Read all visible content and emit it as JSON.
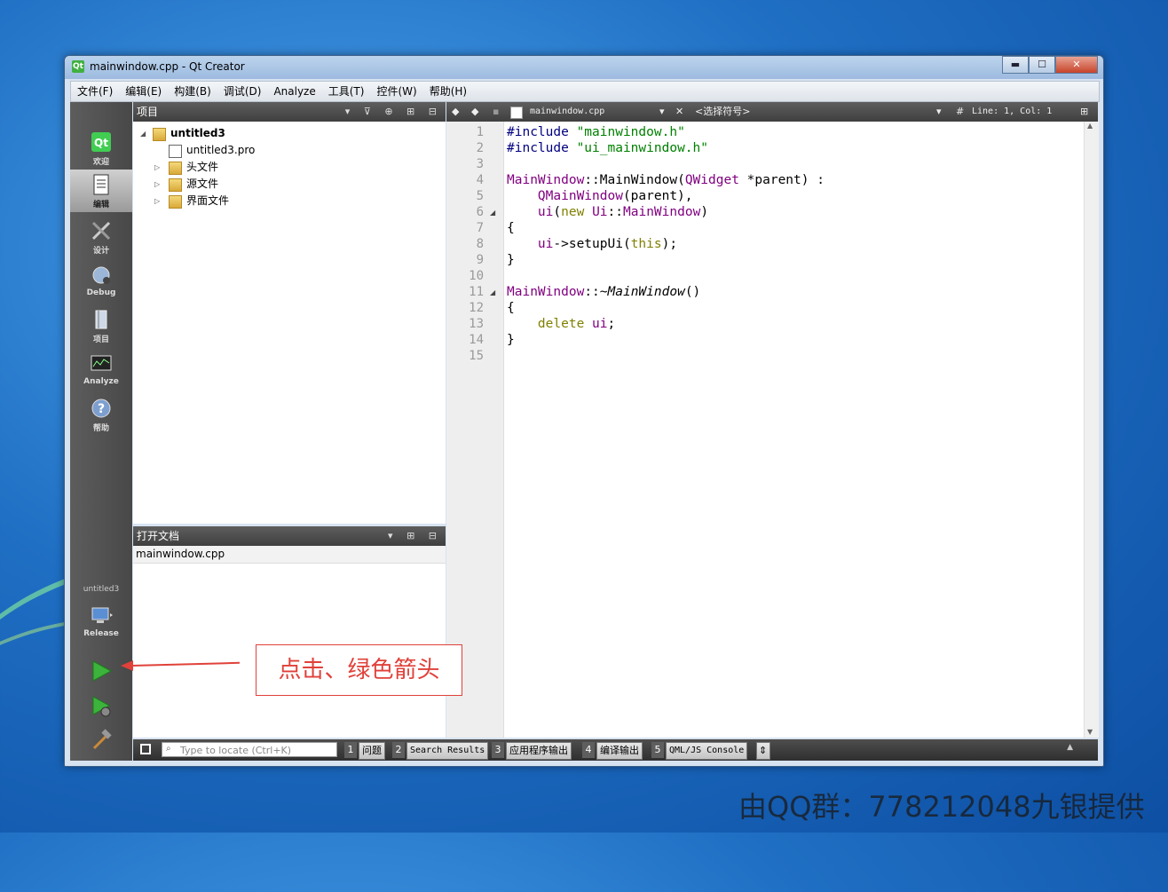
{
  "window": {
    "title": "mainwindow.cpp - Qt Creator",
    "app_icon_text": "Qt",
    "min": "▬",
    "max": "☐",
    "close": "✕"
  },
  "menu": [
    "文件(F)",
    "编辑(E)",
    "构建(B)",
    "调试(D)",
    "Analyze",
    "工具(T)",
    "控件(W)",
    "帮助(H)"
  ],
  "modes": {
    "welcome": "欢迎",
    "edit": "编辑",
    "design": "设计",
    "debug": "Debug",
    "projects": "项目",
    "analyze": "Analyze",
    "help": "帮助"
  },
  "build": {
    "project": "untitled3",
    "config": "Release"
  },
  "project_panel": {
    "title": "项目",
    "tree": [
      {
        "label": "untitled3",
        "level": 0,
        "bold": true
      },
      {
        "label": "untitled3.pro",
        "level": 1
      },
      {
        "label": "头文件",
        "level": 1
      },
      {
        "label": "源文件",
        "level": 1
      },
      {
        "label": "界面文件",
        "level": 1
      }
    ]
  },
  "open_docs": {
    "title": "打开文档",
    "items": [
      "mainwindow.cpp"
    ]
  },
  "editor": {
    "file": "mainwindow.cpp",
    "symbol": "<选择符号>",
    "position": "Line: 1, Col: 1",
    "hash": "#",
    "lines": [
      "1",
      "2",
      "3",
      "4",
      "5",
      "6",
      "7",
      "8",
      "9",
      "10",
      "11",
      "12",
      "13",
      "14",
      "15"
    ]
  },
  "code": {
    "l1a": "#include ",
    "l1b": "\"mainwindow.h\"",
    "l2a": "#include ",
    "l2b": "\"ui_mainwindow.h\"",
    "l4a": "MainWindow",
    "l4b": "::MainWindow(",
    "l4c": "QWidget",
    "l4d": " *parent) :",
    "l5a": "    ",
    "l5b": "QMainWindow",
    "l5c": "(parent),",
    "l6a": "    ",
    "l6b": "ui",
    "l6c": "(",
    "l6d": "new",
    "l6e": " ",
    "l6f": "Ui",
    "l6g": "::",
    "l6h": "MainWindow",
    "l6i": ")",
    "l7": "{",
    "l8a": "    ",
    "l8b": "ui",
    "l8c": "->setupUi(",
    "l8d": "this",
    "l8e": ");",
    "l9": "}",
    "l11a": "MainWindow",
    "l11b": "::~",
    "l11c": "MainWindow",
    "l11d": "()",
    "l12": "{",
    "l13a": "    ",
    "l13b": "delete",
    "l13c": " ",
    "l13d": "ui",
    "l13e": ";",
    "l14": "}"
  },
  "status": {
    "locate_placeholder": "Type to locate (Ctrl+K)",
    "tabs": [
      {
        "num": "1",
        "label": "问题"
      },
      {
        "num": "2",
        "label": "Search Results"
      },
      {
        "num": "3",
        "label": "应用程序输出"
      },
      {
        "num": "4",
        "label": "编译输出"
      },
      {
        "num": "5",
        "label": "QML/JS Console"
      }
    ]
  },
  "annotation": "点击、绿色箭头",
  "watermark": "由QQ群：778212048九银提供"
}
